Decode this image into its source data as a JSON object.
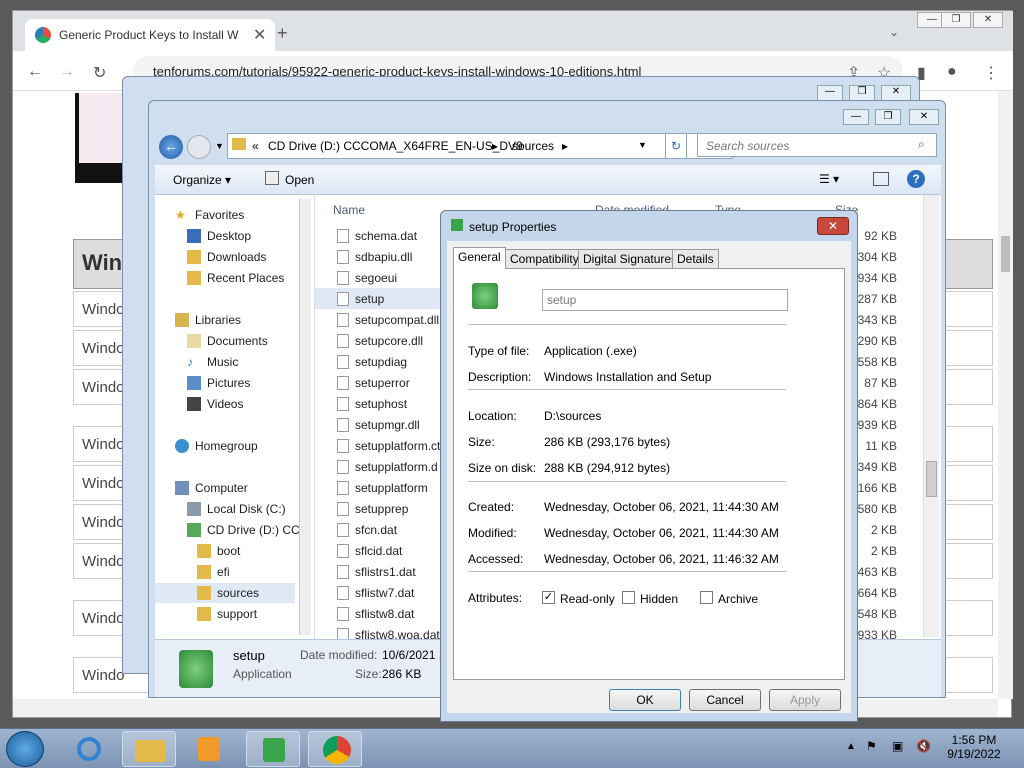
{
  "browser": {
    "tab_title": "Generic Product Keys to Install W",
    "url": "tenforums.com/tutorials/95922-generic-product-keys-install-windows-10-editions.html",
    "page_heading": "Win",
    "page_rows": [
      "Windo",
      "Windo",
      "Windo",
      "Windo",
      "Windo",
      "Windo",
      "Windo",
      "Windo",
      "Windo"
    ]
  },
  "explorer": {
    "breadcrumb": [
      "«",
      "CD Drive (D:) CCCOMA_X64FRE_EN-US_DV9",
      "sources"
    ],
    "search_placeholder": "Search sources",
    "toolbar": {
      "organize": "Organize",
      "open": "Open"
    },
    "nav": {
      "favorites": "Favorites",
      "fav_items": [
        "Desktop",
        "Downloads",
        "Recent Places"
      ],
      "libraries": "Libraries",
      "lib_items": [
        "Documents",
        "Music",
        "Pictures",
        "Videos"
      ],
      "homegroup": "Homegroup",
      "computer": "Computer",
      "comp_items": [
        "Local Disk (C:)",
        "CD Drive (D:) CC"
      ],
      "folders": [
        "boot",
        "efi",
        "sources",
        "support"
      ]
    },
    "columns": {
      "name": "Name",
      "date": "Date modified",
      "type": "Type",
      "size": "Size"
    },
    "files": [
      {
        "name": "schema.dat",
        "size": "92 KB"
      },
      {
        "name": "sdbapiu.dll",
        "size": "304 KB"
      },
      {
        "name": "segoeui",
        "size": "934 KB"
      },
      {
        "name": "setup",
        "size": "287 KB"
      },
      {
        "name": "setupcompat.dll",
        "size": "343 KB"
      },
      {
        "name": "setupcore.dll",
        "size": "2,290 KB"
      },
      {
        "name": "setupdiag",
        "size": "558 KB"
      },
      {
        "name": "setuperror",
        "size": "87 KB"
      },
      {
        "name": "setuphost",
        "size": "864 KB"
      },
      {
        "name": "setupmgr.dll",
        "size": "939 KB"
      },
      {
        "name": "setupplatform.ct",
        "size": "11 KB"
      },
      {
        "name": "setupplatform.d",
        "size": "9,349 KB"
      },
      {
        "name": "setupplatform",
        "size": "166 KB"
      },
      {
        "name": "setupprep",
        "size": "0,580 KB"
      },
      {
        "name": "sfcn.dat",
        "size": "2 KB"
      },
      {
        "name": "sflcid.dat",
        "size": "2 KB"
      },
      {
        "name": "sflistrs1.dat",
        "size": "3,463 KB"
      },
      {
        "name": "sflistw7.dat",
        "size": "1,664 KB"
      },
      {
        "name": "sflistw8.dat",
        "size": "2,548 KB"
      },
      {
        "name": "sflistw8.woa.dat",
        "size": "933 KB"
      }
    ],
    "details": {
      "name": "setup",
      "type": "Application",
      "date_label": "Date modified:",
      "date_value": "10/6/2021 1",
      "size_label": "Size:",
      "size_value": "286 KB"
    }
  },
  "properties": {
    "title": "setup Properties",
    "tabs": [
      "General",
      "Compatibility",
      "Digital Signatures",
      "Details"
    ],
    "name_field": "setup",
    "rows": {
      "type_label": "Type of file:",
      "type_value": "Application (.exe)",
      "desc_label": "Description:",
      "desc_value": "Windows Installation and Setup",
      "loc_label": "Location:",
      "loc_value": "D:\\sources",
      "size_label": "Size:",
      "size_value": "286 KB (293,176 bytes)",
      "disk_label": "Size on disk:",
      "disk_value": "288 KB (294,912 bytes)",
      "created_label": "Created:",
      "created_value": "Wednesday, October 06, 2021, 11:44:30 AM",
      "modified_label": "Modified:",
      "modified_value": "Wednesday, October 06, 2021, 11:44:30 AM",
      "accessed_label": "Accessed:",
      "accessed_value": "Wednesday, October 06, 2021, 11:46:32 AM",
      "attr_label": "Attributes:"
    },
    "attributes": {
      "readonly": "Read-only",
      "hidden": "Hidden",
      "archive": "Archive"
    },
    "buttons": {
      "ok": "OK",
      "cancel": "Cancel",
      "apply": "Apply"
    }
  },
  "taskbar": {
    "time": "1:56 PM",
    "date": "9/19/2022"
  }
}
